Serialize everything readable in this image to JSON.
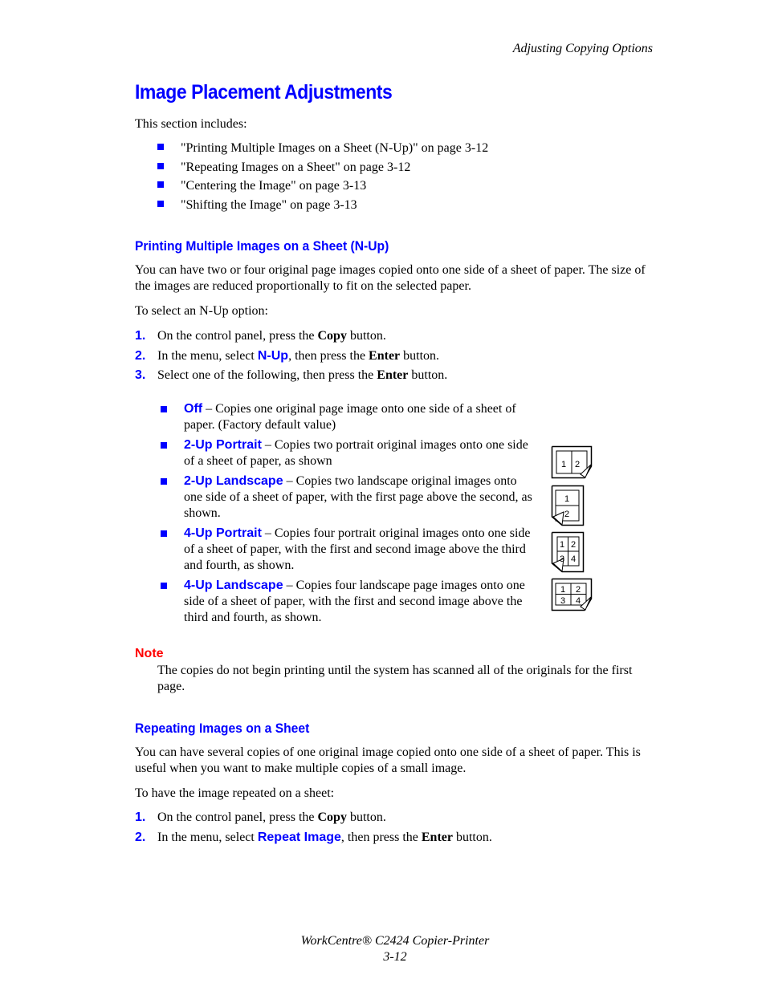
{
  "header": {
    "section": "Adjusting Copying Options"
  },
  "title": "Image Placement Adjustments",
  "intro": "This section includes:",
  "toc": [
    "\"Printing Multiple Images on a Sheet (N-Up)\" on page 3-12",
    "\"Repeating Images on a Sheet\" on page 3-12",
    "\"Centering the Image\" on page 3-13",
    "\"Shifting the Image\" on page 3-13"
  ],
  "nup": {
    "heading": "Printing Multiple Images on a Sheet (N-Up)",
    "para": "You can have two or four original page images copied onto one side of a sheet of paper. The size of the images are reduced proportionally to fit on the selected paper.",
    "lead": "To select an N-Up option:",
    "steps": [
      {
        "num": "1.",
        "pre": "On the control panel, press the ",
        "bold": "Copy",
        "post": " button."
      },
      {
        "num": "2.",
        "pre": "In the menu, select ",
        "kw": "N-Up",
        "mid": ", then press the ",
        "bold": "Enter",
        "post": " button."
      },
      {
        "num": "3.",
        "pre": "Select one of the following, then press the ",
        "bold": "Enter",
        "post": " button."
      }
    ],
    "options": [
      {
        "name": "Off",
        "desc": " – Copies one original page image onto one side of a sheet of paper. (Factory default value)"
      },
      {
        "name": "2-Up Portrait",
        "desc": " – Copies two portrait original images onto one side of a sheet of paper, as shown"
      },
      {
        "name": "2-Up Landscape",
        "desc": " – Copies two landscape original images onto one side of a sheet of paper, with the first page above the second, as shown."
      },
      {
        "name": "4-Up Portrait",
        "desc": " – Copies four portrait original images onto one side of a sheet of paper, with the first and second image above the third and fourth, as shown."
      },
      {
        "name": "4-Up Landscape",
        "desc": " – Copies four landscape page images onto one side of a sheet of paper, with the first and second image above the third and fourth, as shown."
      }
    ],
    "diagram_labels": {
      "two_up_portrait": [
        "1",
        "2"
      ],
      "two_up_landscape": [
        "1",
        "2"
      ],
      "four_up_portrait": [
        "1",
        "2",
        "3",
        "4"
      ],
      "four_up_landscape": [
        "1",
        "2",
        "3",
        "4"
      ]
    }
  },
  "note": {
    "label": "Note",
    "text": "The copies do not begin printing until the system has scanned all of the originals for the first page."
  },
  "repeat": {
    "heading": "Repeating Images on a Sheet",
    "para": "You can have several copies of one original image copied onto one side of a sheet of paper. This is useful when you want to make multiple copies of a small image.",
    "lead": "To have the image repeated on a sheet:",
    "steps": [
      {
        "num": "1.",
        "pre": "On the control panel, press the ",
        "bold": "Copy",
        "post": " button."
      },
      {
        "num": "2.",
        "pre": "In the menu, select ",
        "kw": "Repeat Image",
        "mid": ", then press the ",
        "bold": "Enter",
        "post": " button."
      }
    ]
  },
  "footer": {
    "product": "WorkCentre® C2424 Copier-Printer",
    "page": "3-12"
  }
}
